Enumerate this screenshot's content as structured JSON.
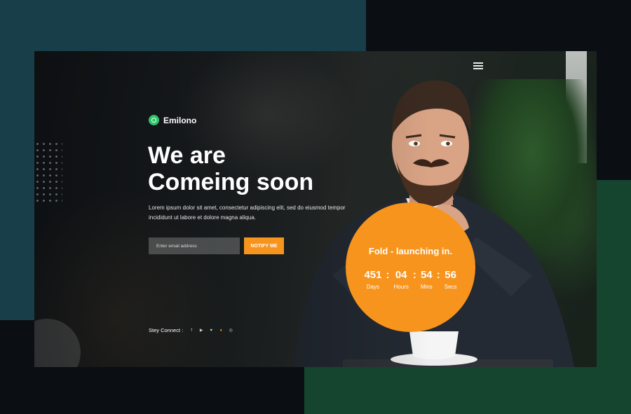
{
  "brand": {
    "name": "Emilono"
  },
  "hero": {
    "line1": "We are",
    "line2": "Comeing soon",
    "description": "Lorem ipsum dolor sit amet, consectetur adipiscing elit, sed do eiusmod tempor incididunt ut labore et dolore magna aliqua."
  },
  "form": {
    "email_placeholder": "Enter email address",
    "notify_label": "NOTIFY ME"
  },
  "social": {
    "label": "Stey Connect :",
    "icons": [
      "facebook-icon",
      "youtube-icon",
      "pinterest-icon",
      "twitter-icon",
      "skype-icon"
    ]
  },
  "countdown": {
    "title": "Fold - launching in.",
    "days": "451",
    "days_label": "Days",
    "hours": "04",
    "hours_label": "Hours",
    "mins": "54",
    "mins_label": "Mins",
    "secs": "56",
    "secs_label": "Secs"
  },
  "colors": {
    "accent": "#f7941d",
    "brand_green": "#2fc36b",
    "teal_bg": "#173e49",
    "green_bg": "#15452f"
  }
}
